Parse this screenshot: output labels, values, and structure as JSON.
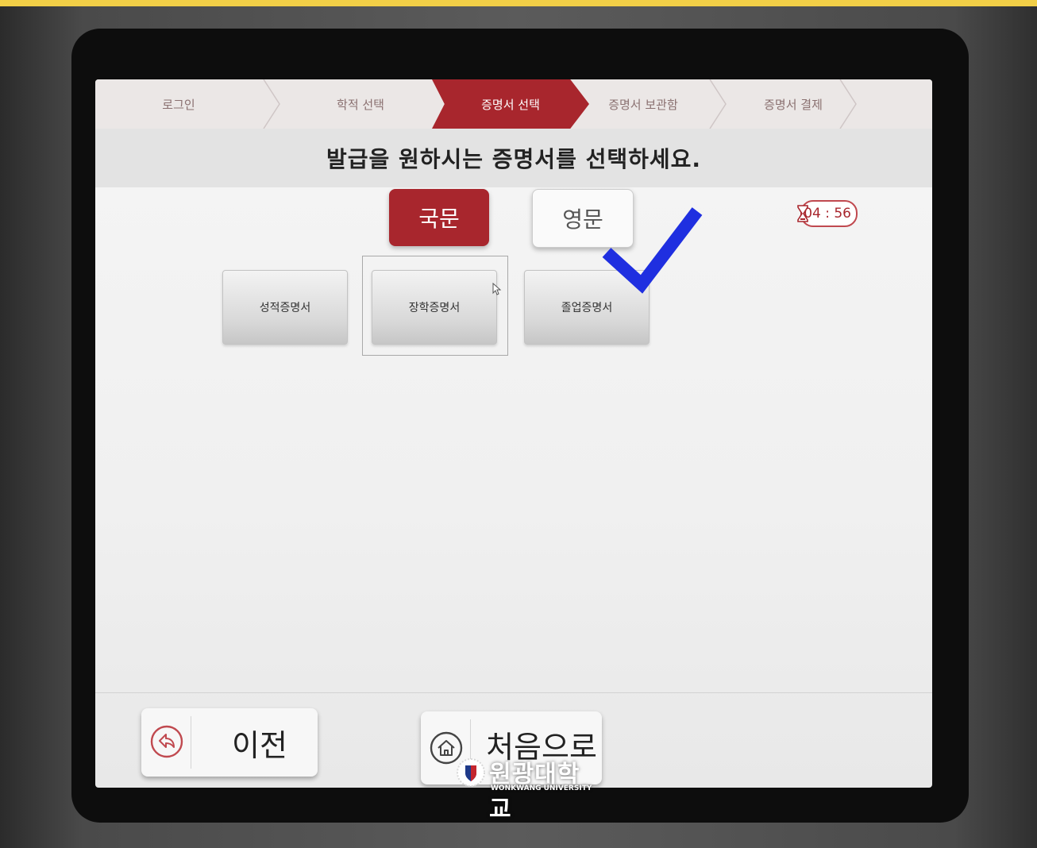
{
  "steps": [
    {
      "label": "로그인"
    },
    {
      "label": "학적 선택"
    },
    {
      "label": "증명서 선택"
    },
    {
      "label": "증명서 보관함"
    },
    {
      "label": "증명서 결제"
    }
  ],
  "active_step": "증명서 선택",
  "heading": "발급을 원하시는 증명서를 선택하세요.",
  "language": {
    "korean": "국문",
    "english": "영문",
    "selected": "국문"
  },
  "timer": "04 : 56",
  "certificates": [
    {
      "label": "성적증명서"
    },
    {
      "label": "장학증명서"
    },
    {
      "label": "졸업증명서"
    }
  ],
  "annotation": {
    "checkmark_color": "#1f2fe0",
    "marks": "졸업증명서"
  },
  "footer": {
    "prev_label": "이전",
    "home_label": "처음으로"
  },
  "watermark": {
    "name": "원광대학교",
    "sub": "WONKWANG UNIVERSITY"
  },
  "colors": {
    "accent": "#a8262d",
    "highlight": "#f2cf47"
  }
}
